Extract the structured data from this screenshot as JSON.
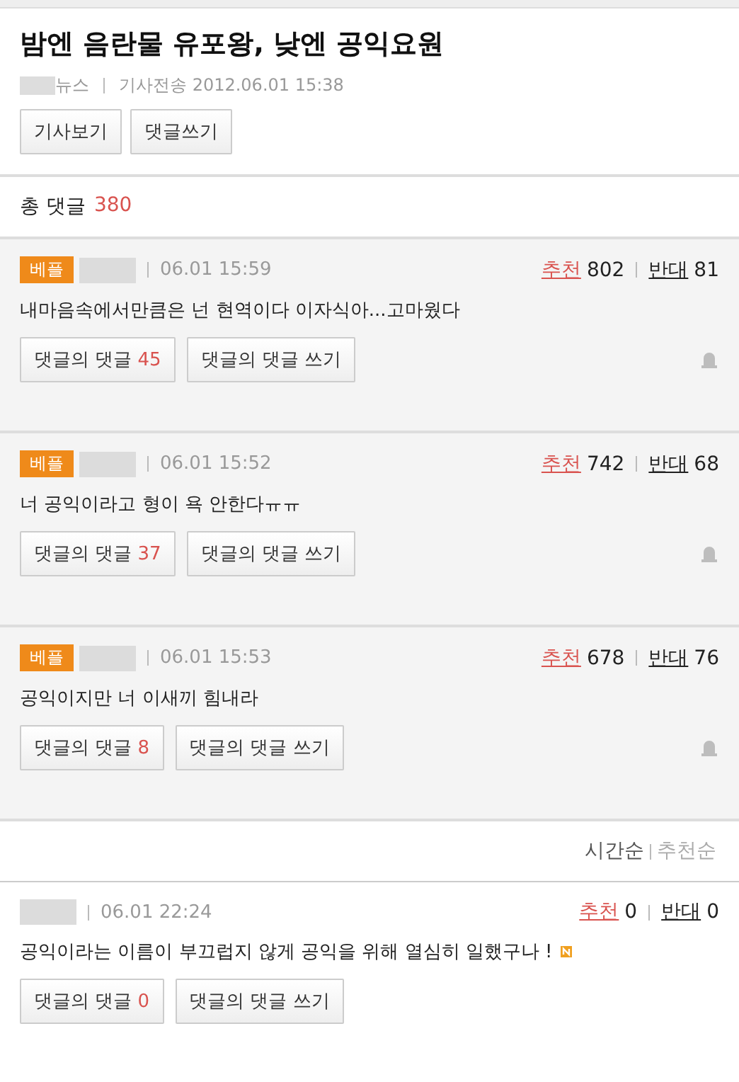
{
  "article": {
    "title": "밤엔 음란물 유포왕, 낮엔 공익요원",
    "source": "뉴스",
    "sent": "기사전송 2012.06.01 15:38",
    "buttons": [
      "기사보기",
      "댓글쓰기"
    ]
  },
  "total": {
    "label": "총 댓글",
    "count": "380"
  },
  "best_comments": [
    {
      "badge": "베플",
      "time": "06.01 15:59",
      "like_label": "추천",
      "likes": "802",
      "dislike_label": "반대",
      "dislikes": "81",
      "text": "내마음속에서만큼은 넌 현역이다 이자식아...고마웠다",
      "reply_label": "댓글의 댓글",
      "reply_count": "45",
      "write_label": "댓글의 댓글 쓰기"
    },
    {
      "badge": "베플",
      "time": "06.01 15:52",
      "like_label": "추천",
      "likes": "742",
      "dislike_label": "반대",
      "dislikes": "68",
      "text": "너 공익이라고 형이 욕 안한다ㅠㅠ",
      "reply_label": "댓글의 댓글",
      "reply_count": "37",
      "write_label": "댓글의 댓글 쓰기"
    },
    {
      "badge": "베플",
      "time": "06.01 15:53",
      "like_label": "추천",
      "likes": "678",
      "dislike_label": "반대",
      "dislikes": "76",
      "text": "공익이지만 너 이새끼 힘내라",
      "reply_label": "댓글의 댓글",
      "reply_count": "8",
      "write_label": "댓글의 댓글 쓰기"
    }
  ],
  "sort": [
    {
      "label": "시간순",
      "selected": true
    },
    {
      "label": "추천순",
      "selected": false
    }
  ],
  "comments": [
    {
      "time": "06.01 22:24",
      "like_label": "추천",
      "likes": "0",
      "dislike_label": "반대",
      "dislikes": "0",
      "text": "공익이라는 이름이 부끄럽지 않게 공익을 위해 열심히 일했구나 !",
      "new": true,
      "reply_label": "댓글의 댓글",
      "reply_count": "0",
      "write_label": "댓글의 댓글 쓰기"
    }
  ]
}
